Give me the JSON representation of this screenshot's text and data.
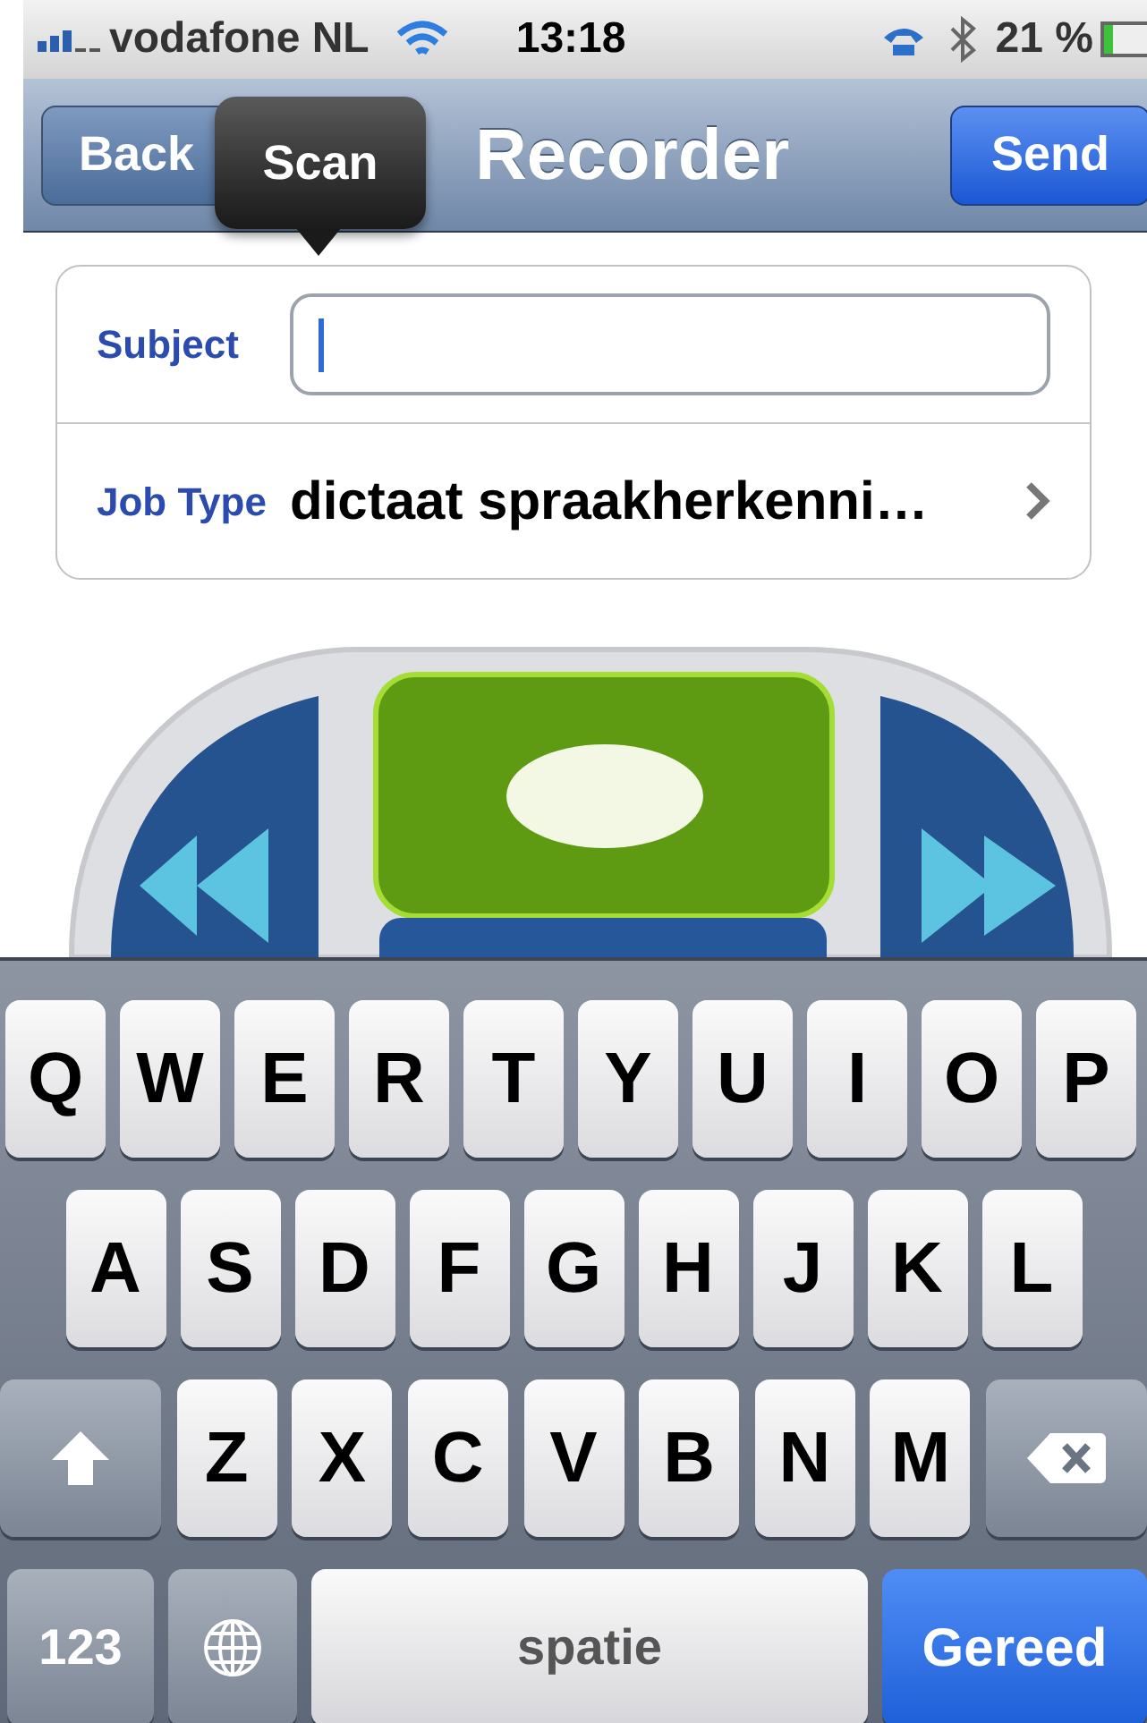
{
  "status_bar": {
    "carrier": "vodafone NL",
    "time": "13:18",
    "battery": "21 %"
  },
  "nav": {
    "back": "Back",
    "tooltip": "Scan",
    "title": "Recorder",
    "send": "Send"
  },
  "form": {
    "rows": [
      {
        "kind": "input",
        "label": "Subject",
        "focused": true
      },
      {
        "kind": "disclosure",
        "label": "Job Type",
        "value": "dictaat spraakherkenni…"
      }
    ]
  },
  "keyboard": {
    "rows": [
      {
        "keys": [
          {
            "kind": "letter",
            "label": "Q"
          },
          {
            "kind": "letter",
            "label": "W"
          },
          {
            "kind": "letter",
            "label": "E"
          },
          {
            "kind": "letter",
            "label": "R"
          },
          {
            "kind": "letter",
            "label": "T"
          },
          {
            "kind": "letter",
            "label": "Y"
          },
          {
            "kind": "letter",
            "label": "U"
          },
          {
            "kind": "letter",
            "label": "I"
          },
          {
            "kind": "letter",
            "label": "O"
          },
          {
            "kind": "letter",
            "label": "P"
          }
        ]
      },
      {
        "keys": [
          {
            "kind": "letter",
            "label": "A"
          },
          {
            "kind": "letter",
            "label": "S"
          },
          {
            "kind": "letter",
            "label": "D"
          },
          {
            "kind": "letter",
            "label": "F"
          },
          {
            "kind": "letter",
            "label": "G"
          },
          {
            "kind": "letter",
            "label": "H"
          },
          {
            "kind": "letter",
            "label": "J"
          },
          {
            "kind": "letter",
            "label": "K"
          },
          {
            "kind": "letter",
            "label": "L"
          }
        ]
      },
      {
        "keys": [
          {
            "kind": "shift"
          },
          {
            "kind": "letter",
            "label": "Z"
          },
          {
            "kind": "letter",
            "label": "X"
          },
          {
            "kind": "letter",
            "label": "C"
          },
          {
            "kind": "letter",
            "label": "V"
          },
          {
            "kind": "letter",
            "label": "B"
          },
          {
            "kind": "letter",
            "label": "N"
          },
          {
            "kind": "letter",
            "label": "M"
          },
          {
            "kind": "delete"
          }
        ]
      },
      {
        "keys": [
          {
            "kind": "mode",
            "label": "123"
          },
          {
            "kind": "globe"
          },
          {
            "kind": "space",
            "label": "spatie"
          },
          {
            "kind": "done",
            "label": "Gereed"
          }
        ]
      }
    ]
  }
}
